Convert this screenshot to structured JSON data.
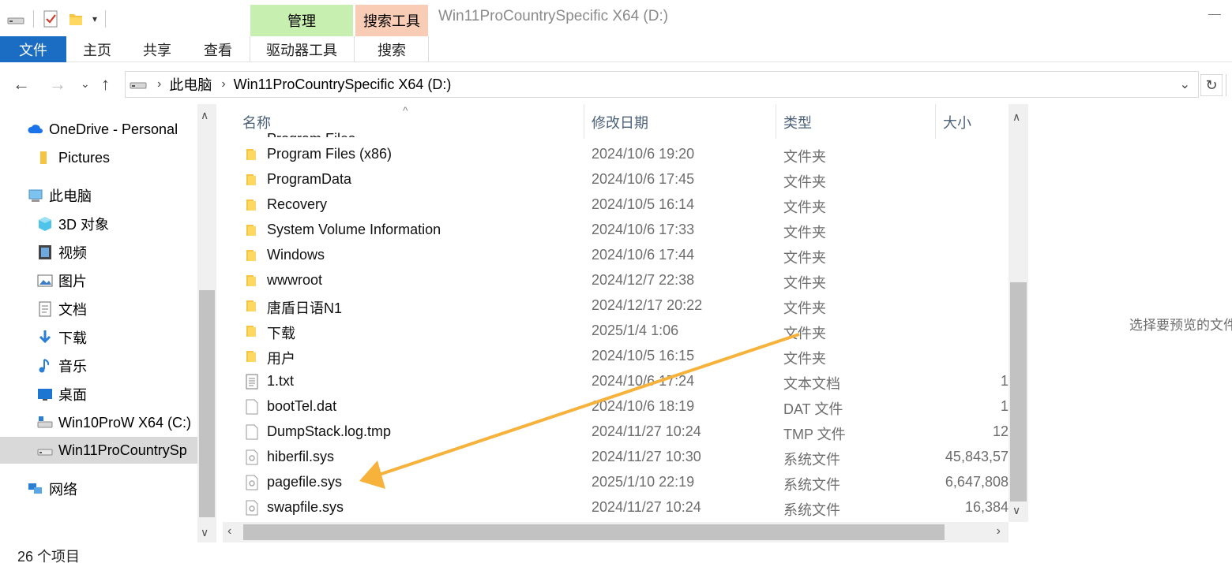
{
  "window": {
    "title": "Win11ProCountrySpecific X64 (D:)",
    "context_tabs": {
      "manage": "管理",
      "search_tools": "搜索工具"
    }
  },
  "ribbon": {
    "tabs": [
      "文件",
      "主页",
      "共享",
      "查看",
      "驱动器工具",
      "搜索"
    ]
  },
  "address": {
    "crumbs": [
      "此电脑",
      "Win11ProCountrySpecific X64 (D:)"
    ]
  },
  "nav": {
    "items": [
      {
        "label": "OneDrive - Personal",
        "icon": "onedrive-icon"
      },
      {
        "label": "Pictures",
        "icon": "folder-icon"
      },
      {
        "label": "此电脑",
        "icon": "computer-icon"
      },
      {
        "label": "3D 对象",
        "icon": "3d-objects-icon"
      },
      {
        "label": "视频",
        "icon": "video-icon"
      },
      {
        "label": "图片",
        "icon": "pictures-icon"
      },
      {
        "label": "文档",
        "icon": "documents-icon"
      },
      {
        "label": "下载",
        "icon": "download-icon"
      },
      {
        "label": "音乐",
        "icon": "music-icon"
      },
      {
        "label": "桌面",
        "icon": "desktop-icon"
      },
      {
        "label": "Win10ProW X64 (C:)",
        "icon": "drive-icon"
      },
      {
        "label": "Win11ProCountrySp",
        "icon": "drive-icon"
      },
      {
        "label": "网络",
        "icon": "network-icon"
      }
    ]
  },
  "filelist": {
    "headers": {
      "name": "名称",
      "modified": "修改日期",
      "type": "类型",
      "size": "大小"
    },
    "rows": [
      {
        "name": "Program Files (x86)",
        "date": "2024/10/6 19:20",
        "type": "文件夹",
        "size": "",
        "icon": "folder-icon"
      },
      {
        "name": "ProgramData",
        "date": "2024/10/6 17:45",
        "type": "文件夹",
        "size": "",
        "icon": "folder-icon"
      },
      {
        "name": "Recovery",
        "date": "2024/10/5 16:14",
        "type": "文件夹",
        "size": "",
        "icon": "folder-icon"
      },
      {
        "name": "System Volume Information",
        "date": "2024/10/6 17:33",
        "type": "文件夹",
        "size": "",
        "icon": "folder-icon"
      },
      {
        "name": "Windows",
        "date": "2024/10/6 17:44",
        "type": "文件夹",
        "size": "",
        "icon": "folder-icon"
      },
      {
        "name": "wwwroot",
        "date": "2024/12/7 22:38",
        "type": "文件夹",
        "size": "",
        "icon": "folder-icon"
      },
      {
        "name": "唐盾日语N1",
        "date": "2024/12/17 20:22",
        "type": "文件夹",
        "size": "",
        "icon": "folder-icon"
      },
      {
        "name": "下载",
        "date": "2025/1/4 1:06",
        "type": "文件夹",
        "size": "",
        "icon": "folder-icon"
      },
      {
        "name": "用户",
        "date": "2024/10/5 16:15",
        "type": "文件夹",
        "size": "",
        "icon": "folder-icon"
      },
      {
        "name": "1.txt",
        "date": "2024/10/6 17:24",
        "type": "文本文档",
        "size": "1",
        "icon": "text-file-icon"
      },
      {
        "name": "bootTel.dat",
        "date": "2024/10/6 18:19",
        "type": "DAT 文件",
        "size": "1",
        "icon": "file-icon"
      },
      {
        "name": "DumpStack.log.tmp",
        "date": "2024/11/27 10:24",
        "type": "TMP 文件",
        "size": "12",
        "icon": "file-icon"
      },
      {
        "name": "hiberfil.sys",
        "date": "2024/11/27 10:30",
        "type": "系统文件",
        "size": "45,843,57",
        "icon": "system-file-icon"
      },
      {
        "name": "pagefile.sys",
        "date": "2025/1/10 22:19",
        "type": "系统文件",
        "size": "6,647,808",
        "icon": "system-file-icon"
      },
      {
        "name": "swapfile.sys",
        "date": "2024/11/27 10:24",
        "type": "系统文件",
        "size": "16,384",
        "icon": "system-file-icon"
      }
    ]
  },
  "preview": {
    "text": "选择要预览的文件"
  },
  "status": {
    "count": "26 个项目"
  },
  "colors": {
    "file_tab": "#1a6dc2",
    "manage": "#c6efb0",
    "search_tools": "#f9cdb5",
    "annotation_arrow": "#f7b23b"
  }
}
